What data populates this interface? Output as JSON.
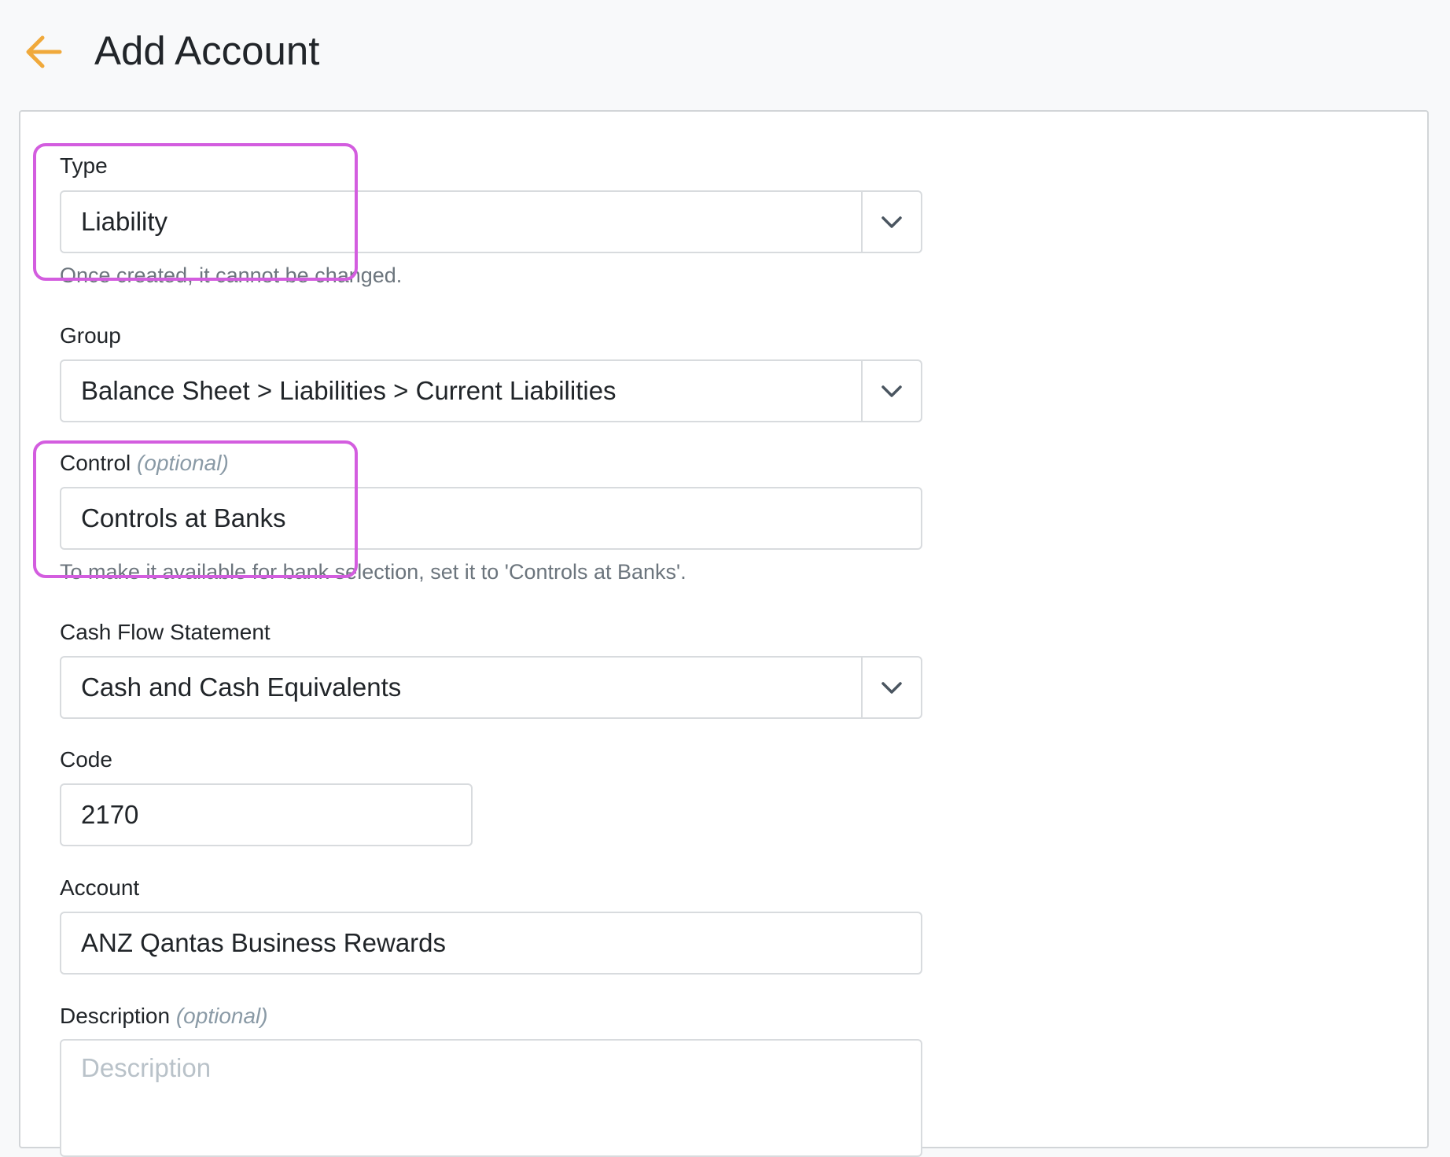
{
  "header": {
    "title": "Add Account"
  },
  "form": {
    "type": {
      "label": "Type",
      "value": "Liability",
      "help": "Once created, it cannot be changed."
    },
    "group": {
      "label": "Group",
      "value": "Balance Sheet > Liabilities > Current Liabilities"
    },
    "control": {
      "label": "Control",
      "optional": "(optional)",
      "value": "Controls at Banks",
      "help": "To make it available for bank selection, set it to 'Controls at Banks'."
    },
    "cash_flow": {
      "label": "Cash Flow Statement",
      "value": "Cash and Cash Equivalents"
    },
    "code": {
      "label": "Code",
      "value": "2170"
    },
    "account": {
      "label": "Account",
      "value": "ANZ Qantas Business Rewards"
    },
    "description": {
      "label": "Description",
      "optional": "(optional)",
      "placeholder": "Description"
    }
  },
  "colors": {
    "accent": "#f0a93b",
    "highlight": "#d35ddf",
    "caret": "#4a5560"
  },
  "icons": {
    "back": "arrow-left-icon",
    "dropdown": "chevron-down-icon"
  }
}
